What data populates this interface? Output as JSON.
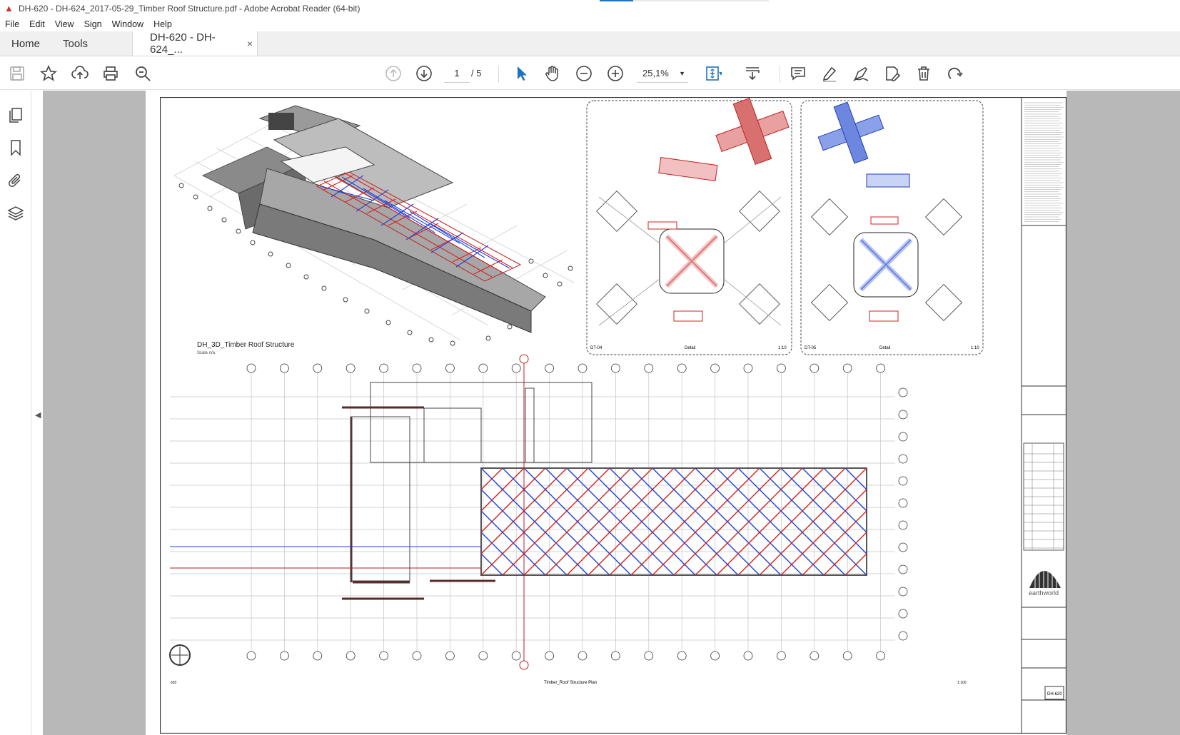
{
  "window": {
    "title": "DH-620 - DH-624_2017-05-29_Timber Roof Structure.pdf - Adobe Acrobat Reader (64-bit)"
  },
  "menu": [
    "File",
    "Edit",
    "View",
    "Sign",
    "Window",
    "Help"
  ],
  "tabs": {
    "home": "Home",
    "tools": "Tools",
    "document": "DH-620 - DH-624_...",
    "close": "×"
  },
  "toolbar": {
    "page_current": "1",
    "page_total": "/ 5",
    "zoom": "25,1%"
  },
  "icons": [
    "save-icon",
    "bookmark-star-icon",
    "upload-cloud-icon",
    "print-icon",
    "search-zoom-icon",
    "prev-page-icon",
    "next-page-icon",
    "select-cursor-icon",
    "hand-tool-icon",
    "zoom-out-icon",
    "zoom-in-icon",
    "fit-page-icon",
    "scroll-mode-icon",
    "comment-icon",
    "highlight-icon",
    "sign-icon",
    "fill-sign-icon",
    "delete-icon",
    "rotate-icon",
    "pages-panel-icon",
    "bookmarks-panel-icon",
    "attachments-panel-icon",
    "layers-panel-icon"
  ],
  "drawing": {
    "view_3d_title": "DH_3D_Timber Roof Structure",
    "view_3d_scale": "Scale n/a",
    "detail_left_id": "DT-04",
    "detail_left_label": "Detail",
    "detail_left_scale": "1:10",
    "detail_right_id": "DT-05",
    "detail_right_label": "Detail",
    "detail_right_scale": "1:10",
    "plan_title": "Timber_Roof Structure Plan",
    "plan_number": "620",
    "plan_scale": "1:100",
    "sheet_id": "DH-620",
    "brand": "earthworld"
  },
  "colors": {
    "accent": "#1e73be",
    "red_member": "#d62020",
    "blue_member": "#2040d8",
    "viewer_bg": "#b8b8b8"
  }
}
